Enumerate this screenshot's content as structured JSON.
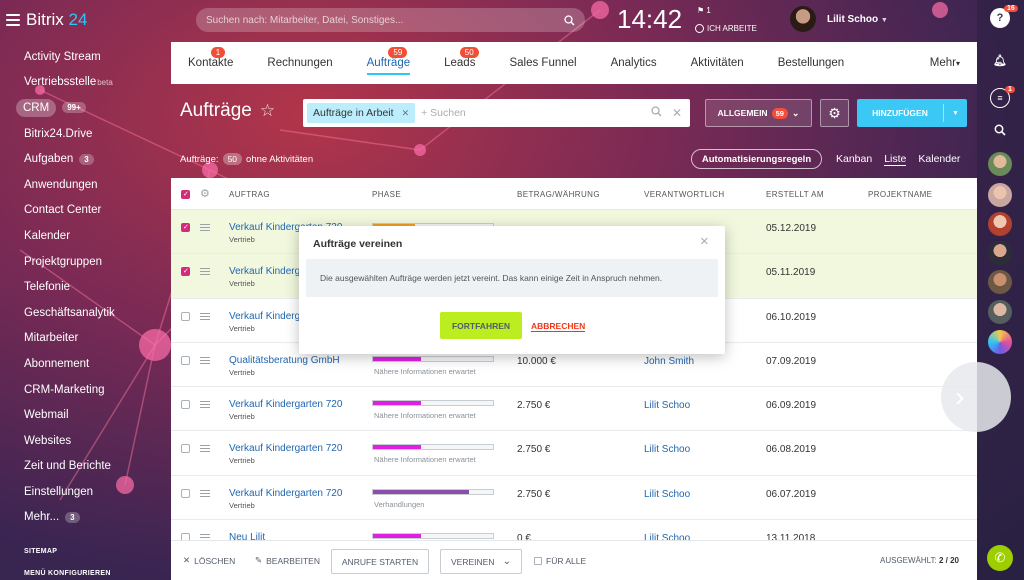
{
  "brand": {
    "name": "Bitrix",
    "suffix": "24"
  },
  "sidebar": {
    "items": [
      {
        "label": "Activity Stream"
      },
      {
        "label": "Vertriebsstelle",
        "sup": "beta"
      },
      {
        "label": "CRM",
        "badge": "99+"
      },
      {
        "label": "Bitrix24.Drive"
      },
      {
        "label": "Aufgaben",
        "badge": "3"
      },
      {
        "label": "Anwendungen"
      },
      {
        "label": "Contact Center"
      },
      {
        "label": "Kalender"
      },
      {
        "label": "Projektgruppen"
      },
      {
        "label": "Telefonie"
      },
      {
        "label": "Geschäftsanalytik"
      },
      {
        "label": "Mitarbeiter"
      },
      {
        "label": "Abonnement"
      },
      {
        "label": "CRM-Marketing"
      },
      {
        "label": "Webmail"
      },
      {
        "label": "Websites"
      },
      {
        "label": "Zeit und Berichte"
      },
      {
        "label": "Einstellungen"
      },
      {
        "label": "Mehr...",
        "badge": "3"
      }
    ],
    "sitemap": "SITEMAP",
    "menu_config": "MENÜ KONFIGURIEREN"
  },
  "topbar": {
    "search_placeholder": "Suchen nach: Mitarbeiter, Datei, Sonstiges...",
    "clock": "14:42",
    "flag_count": "1",
    "work_status": "ICH ARBEITE",
    "user_name": "Lilit Schoo"
  },
  "tabs": [
    {
      "label": "Kontakte",
      "count": "1"
    },
    {
      "label": "Rechnungen",
      "count": ""
    },
    {
      "label": "Aufträge",
      "count": "59",
      "active": true
    },
    {
      "label": "Leads",
      "count": "50"
    },
    {
      "label": "Sales Funnel",
      "count": ""
    },
    {
      "label": "Analytics",
      "count": ""
    },
    {
      "label": "Aktivitäten",
      "count": ""
    },
    {
      "label": "Bestellungen",
      "count": ""
    },
    {
      "label": "Mehr",
      "count": ""
    }
  ],
  "page": {
    "title": "Aufträge",
    "filter_chip": "Aufträge in Arbeit",
    "filter_placeholder": "+ Suchen",
    "preset_label": "ALLGEMEIN",
    "preset_count": "59",
    "add_label": "HINZUFÜGEN",
    "stat_label": "Aufträge:",
    "stat_count": "50",
    "stat_suffix": "ohne Aktivitäten",
    "automation": "Automatisierungsregeln",
    "views": [
      "Kanban",
      "Liste",
      "Kalender"
    ],
    "active_view": "Liste"
  },
  "grid": {
    "columns": [
      "AUFTRAG",
      "PHASE",
      "BETRAG/WÄHRUNG",
      "VERANTWORTLICH",
      "ERSTELLT AM",
      "PROJEKTNAME"
    ],
    "rows": [
      {
        "title": "Verkauf Kindergarten 720",
        "sub": "Vertrieb",
        "phase": "",
        "amount": "",
        "resp": "",
        "date": "05.12.2019",
        "checked": true,
        "bar_color": "#f0a020",
        "fill": 0.35
      },
      {
        "title": "Verkauf Kindergarten 720",
        "sub": "Vertrieb",
        "phase": "",
        "amount": "",
        "resp": "",
        "date": "05.11.2019",
        "checked": true,
        "bar_color": "#e020e0",
        "fill": 0.4
      },
      {
        "title": "Verkauf Kindergarten 720",
        "sub": "Vertrieb",
        "phase": "",
        "amount": "",
        "resp": "",
        "date": "06.10.2019",
        "checked": false,
        "bar_color": "#e020e0",
        "fill": 0.4
      },
      {
        "title": "Qualitätsberatung GmbH",
        "sub": "Vertrieb",
        "phase": "Nähere Informationen erwartet",
        "amount": "10.000 €",
        "resp": "John Smith",
        "date": "07.09.2019",
        "checked": false,
        "bar_color": "#e020e0",
        "fill": 0.4
      },
      {
        "title": "Verkauf Kindergarten 720",
        "sub": "Vertrieb",
        "phase": "Nähere Informationen erwartet",
        "amount": "2.750 €",
        "resp": "Lilit Schoo",
        "date": "06.09.2019",
        "checked": false,
        "bar_color": "#e020e0",
        "fill": 0.4
      },
      {
        "title": "Verkauf Kindergarten 720",
        "sub": "Vertrieb",
        "phase": "Nähere Informationen erwartet",
        "amount": "2.750 €",
        "resp": "Lilit Schoo",
        "date": "06.08.2019",
        "checked": false,
        "bar_color": "#e020e0",
        "fill": 0.4
      },
      {
        "title": "Verkauf Kindergarten 720",
        "sub": "Vertrieb",
        "phase": "Verhandlungen",
        "amount": "2.750 €",
        "resp": "Lilit Schoo",
        "date": "06.07.2019",
        "checked": false,
        "bar_color": "#8a4fa8",
        "fill": 0.8
      },
      {
        "title": "Neu Lilit",
        "sub": "",
        "phase": "",
        "amount": "0 €",
        "resp": "Lilit Schoo",
        "date": "13.11.2018",
        "checked": false,
        "bar_color": "#e020e0",
        "fill": 0.4
      }
    ]
  },
  "modal": {
    "title": "Aufträge vereinen",
    "body": "Die ausgewählten Aufträge werden jetzt vereint. Das kann einige Zeit in Anspruch nehmen.",
    "ok": "FORTFAHREN",
    "cancel": "ABBRECHEN"
  },
  "bottom": {
    "delete": "LÖSCHEN",
    "edit": "BEARBEITEN",
    "calls": "ANRUFE STARTEN",
    "merge": "VEREINEN",
    "for_all": "FÜR ALLE",
    "selected_label": "AUSGEWÄHLT:",
    "selected_value": "2 / 20"
  },
  "rightbar": {
    "help_badge": "16",
    "chat_badge": "1"
  }
}
